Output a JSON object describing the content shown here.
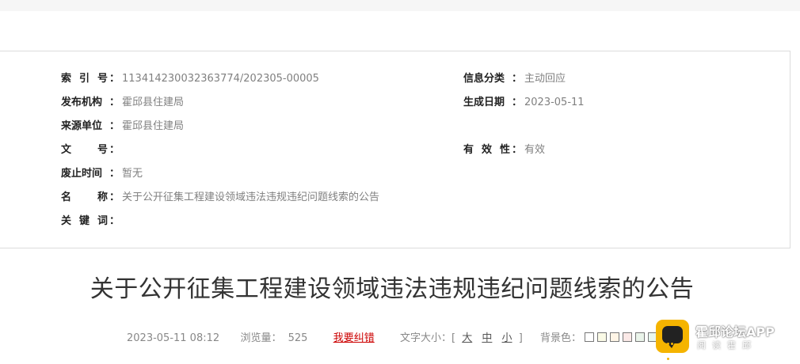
{
  "info": {
    "index_label": "索 引 号",
    "index_value": "113414230032363774/202305-00005",
    "category_label": "信息分类",
    "category_value": "主动回应",
    "publisher_label": "发布机构",
    "publisher_value": "霍邱县住建局",
    "date_label": "生成日期",
    "date_value": "2023-05-11",
    "source_label": "来源单位",
    "source_value": "霍邱县住建局",
    "docno_label": "文 号",
    "docno_value": "",
    "validity_label": "有 效 性",
    "validity_value": "有效",
    "expire_label": "废止时间",
    "expire_value": "暂无",
    "name_label": "名 称",
    "name_value": "关于公开征集工程建设领域违法违规违纪问题线索的公告",
    "keywords_label": "关 键 词",
    "keywords_value": "",
    "colon": "："
  },
  "article": {
    "title": "关于公开征集工程建设领域违法违规违纪问题线索的公告",
    "datetime": "2023-05-11 08:12",
    "views_label": "浏览量：",
    "views_value": "525",
    "report_error": "我要纠错",
    "font_size_label": "文字大小：[",
    "font_large": "大",
    "font_medium": "中",
    "font_small": "小",
    "font_size_end": "]",
    "bg_color_label": "背景色："
  },
  "bg_swatches": [
    "#ffffff",
    "#fafae6",
    "#fff5e6",
    "#fbe9e7",
    "#eaf4ea",
    "#e9f7f0",
    "#eef5fb",
    "#f5f5f5"
  ],
  "badge": {
    "name": "霍邱论坛APP",
    "sub": "阅读霍邱"
  }
}
